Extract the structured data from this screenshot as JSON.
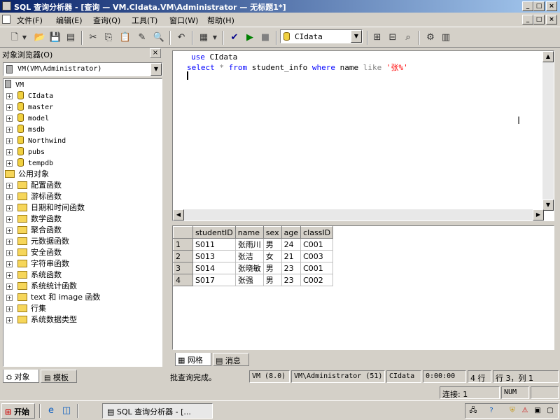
{
  "window": {
    "title": "SQL 查询分析器 - [查询 — VM.CIdata.VM\\Administrator — 无标题1*]",
    "buttons": {
      "min": "_",
      "max": "□",
      "close": "×"
    }
  },
  "menu": [
    "文件(F)",
    "编辑(E)",
    "查询(Q)",
    "工具(T)",
    "窗口(W)",
    "帮助(H)"
  ],
  "toolbar": {
    "database": "CIdata"
  },
  "object_browser": {
    "title": "对象浏览器(O)",
    "close": "×",
    "server": "VM(VM\\Administrator)",
    "server_node": "VM",
    "databases": [
      "CIdata",
      "master",
      "model",
      "msdb",
      "Northwind",
      "pubs",
      "tempdb"
    ],
    "common_objects": "公用对象",
    "folders": [
      "配置函数",
      "游标函数",
      "日期和时间函数",
      "数学函数",
      "聚合函数",
      "元数据函数",
      "安全函数",
      "字符串函数",
      "系统函数",
      "系统统计函数",
      "text 和 image 函数",
      "行集",
      "系统数据类型"
    ],
    "tabs": [
      "对象",
      "模板"
    ]
  },
  "editor": {
    "line1_kw": "use",
    "line1_rest": " CIdata",
    "line2": {
      "select": "select",
      "star": " * ",
      "from": "from",
      "table": " student_info ",
      "where": "where",
      "col": " name ",
      "like": "like",
      "pattern": " '张%'"
    }
  },
  "results": {
    "columns": [
      "studentID",
      "name",
      "sex",
      "age",
      "classID"
    ],
    "rows": [
      {
        "n": "1",
        "cells": [
          "S011",
          "张雨川",
          "男",
          "24",
          "C001"
        ]
      },
      {
        "n": "2",
        "cells": [
          "S013",
          "张洁",
          "女",
          "21",
          "C003"
        ]
      },
      {
        "n": "3",
        "cells": [
          "S014",
          "张晓敏",
          "男",
          "23",
          "C001"
        ]
      },
      {
        "n": "4",
        "cells": [
          "S017",
          "张强",
          "男",
          "23",
          "C002"
        ]
      }
    ],
    "tabs": [
      "网格",
      "消息"
    ]
  },
  "status": {
    "message": "批查询完成。",
    "server": "VM (8.0)",
    "user": "VM\\Administrator (51)",
    "db": "CIdata",
    "time": "0:00:00",
    "rows": "4 行",
    "position": "行 3，列 1",
    "connections": "连接: 1",
    "num": "NUM"
  },
  "taskbar": {
    "start": "开始",
    "task": "SQL 查询分析器 - [..."
  }
}
